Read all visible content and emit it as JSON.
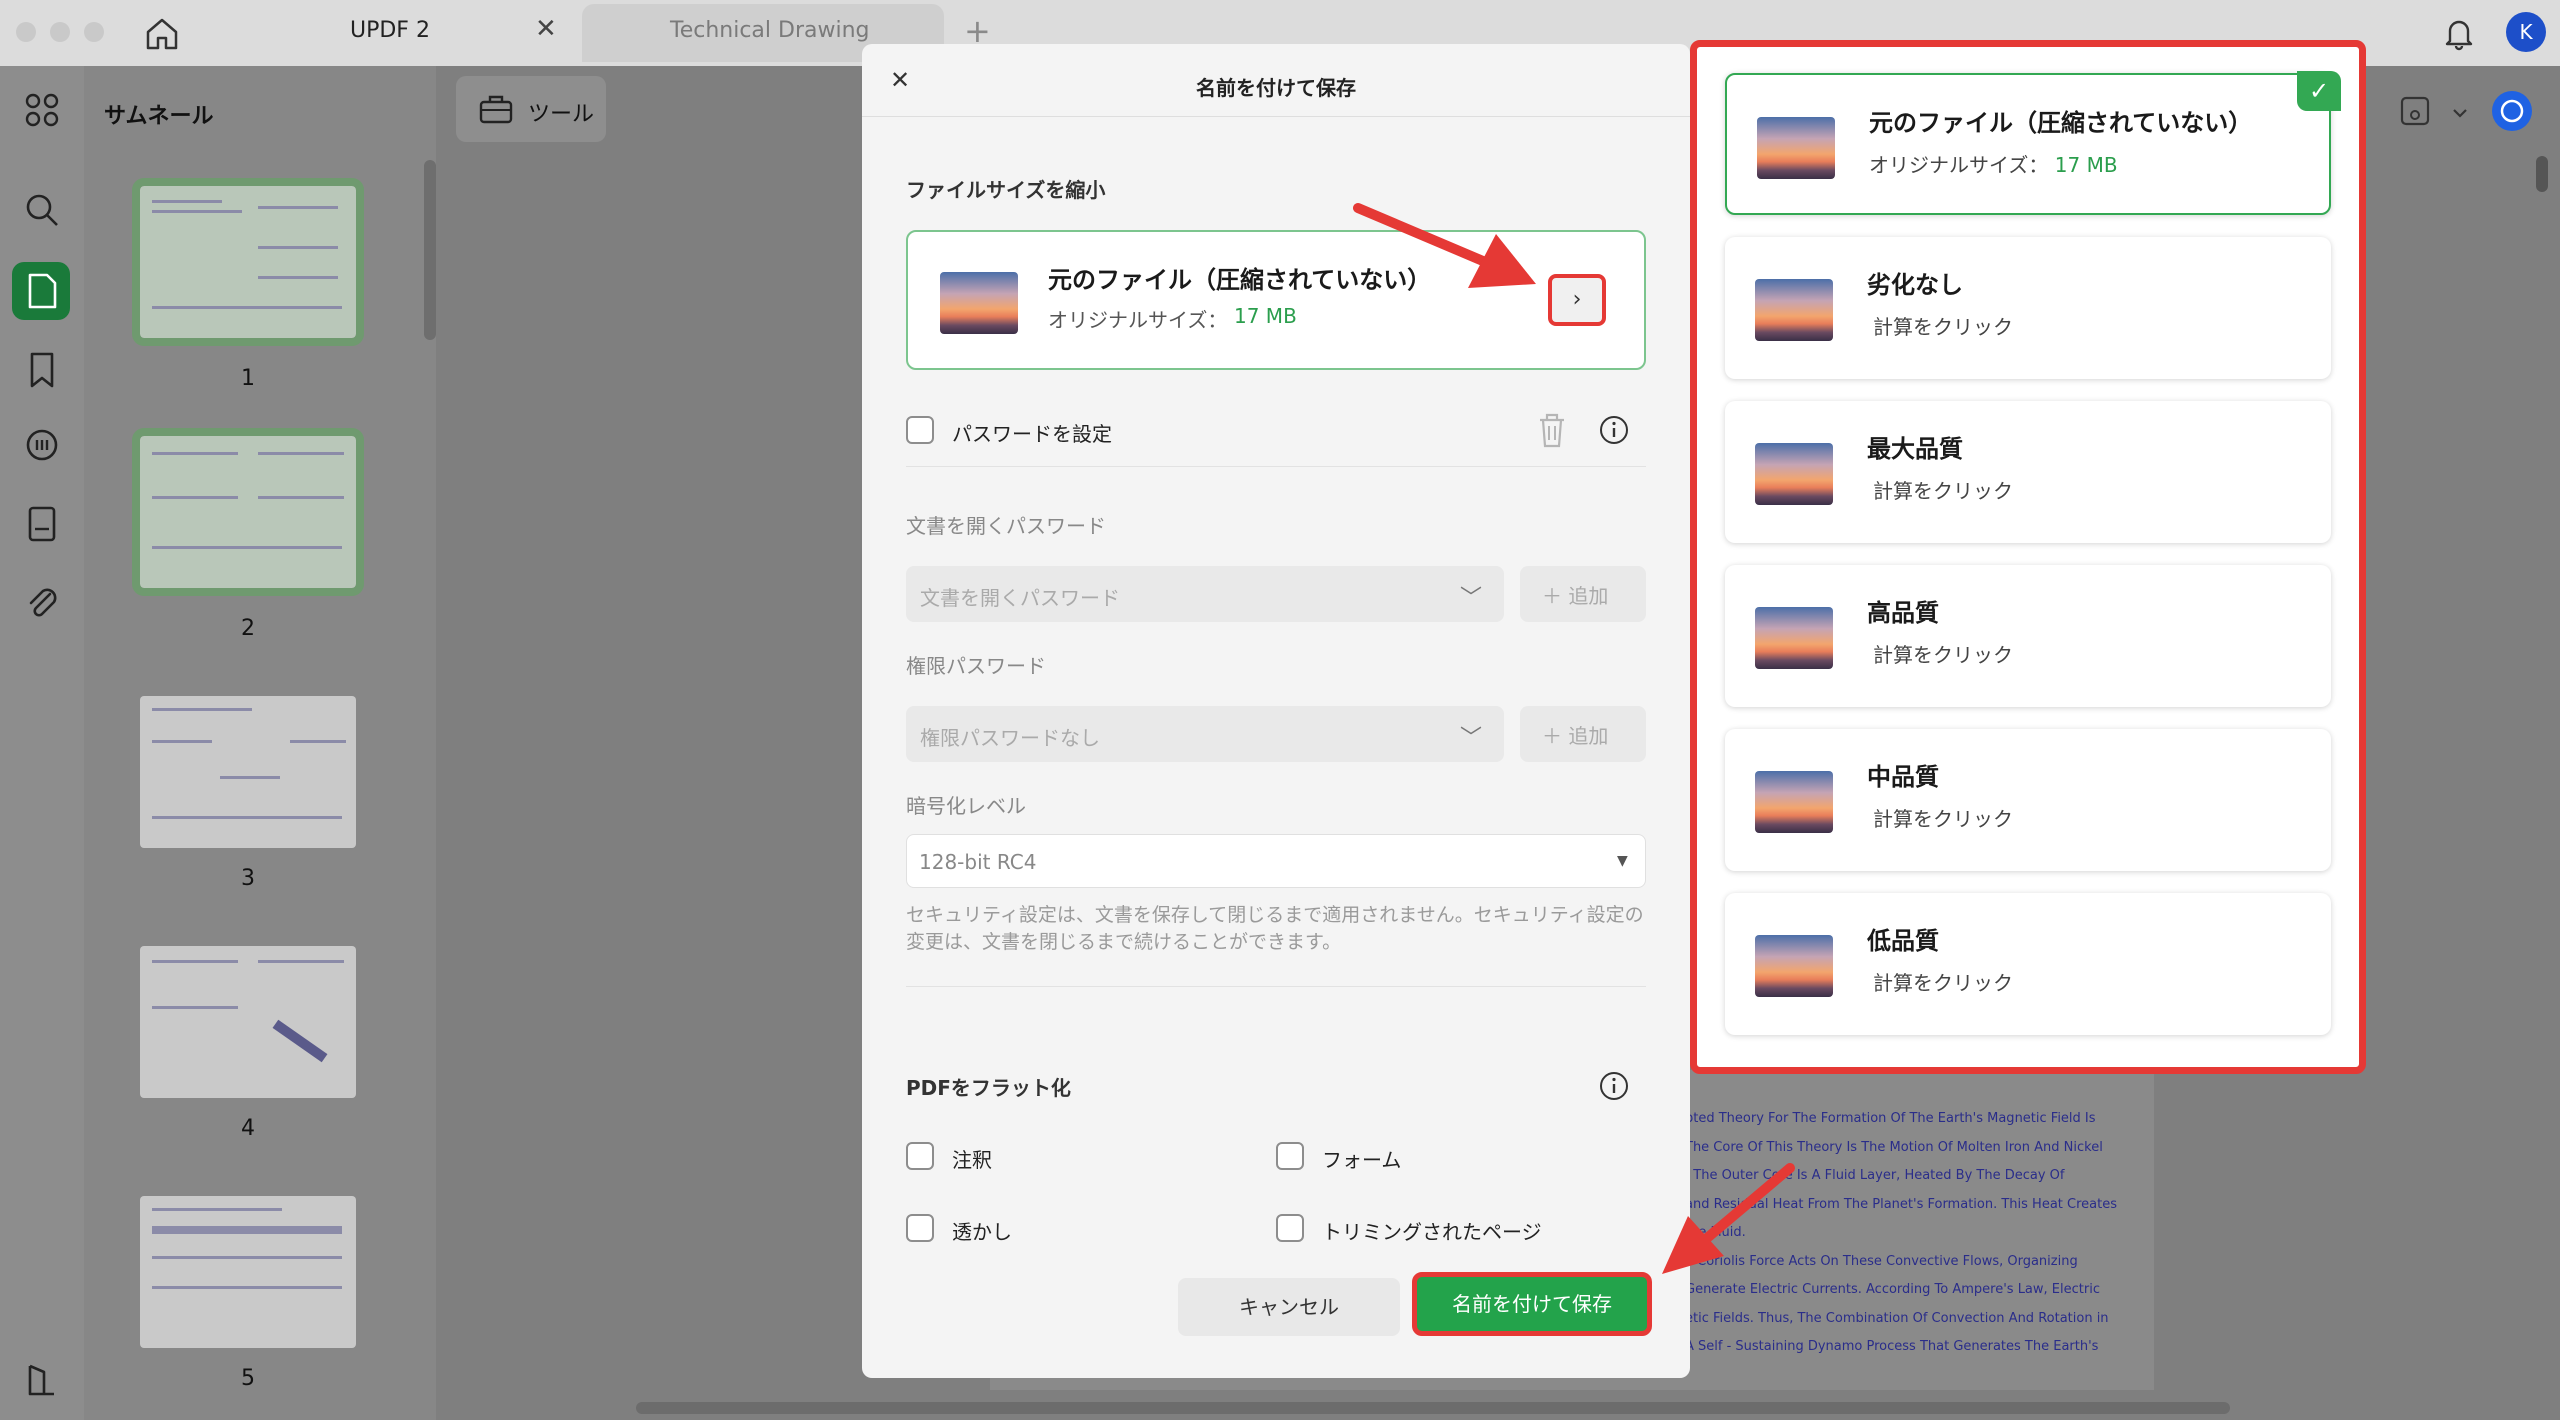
{
  "titlebar": {
    "tab_active": "UPDF 2",
    "tab_close": "✕",
    "tab_inactive": "Technical Drawing",
    "new_tab": "+",
    "avatar_initial": "K"
  },
  "thumbnails": {
    "title": "サムネール",
    "pages": [
      "1",
      "2",
      "3",
      "4",
      "5"
    ]
  },
  "toolbar": {
    "tools_label": "ツール"
  },
  "dialog": {
    "title": "名前を付けて保存",
    "close": "✕",
    "reduce_size_label": "ファイルサイズを縮小",
    "file_card": {
      "title": "元のファイル（圧縮されていない）",
      "size_label": "オリジナルサイズ：",
      "size_value": "17 MB",
      "expand": "›"
    },
    "password": {
      "set_label": "パスワードを設定",
      "open_label": "文書を開くパスワード",
      "open_placeholder": "文書を開くパスワード",
      "perm_label": "権限パスワード",
      "perm_placeholder": "権限パスワードなし",
      "add_label": "追加",
      "encryption_label": "暗号化レベル",
      "encryption_value": "128-bit RC4",
      "note": "セキュリティ設定は、文書を保存して閉じるまで適用されません。セキュリティ設定の変更は、文書を閉じるまで続けることができます。"
    },
    "flatten": {
      "label": "PDFをフラット化",
      "annotations": "注釈",
      "forms": "フォーム",
      "watermark": "透かし",
      "cropped": "トリミングされたページ"
    },
    "cancel": "キャンセル",
    "save": "名前を付けて保存"
  },
  "compression": {
    "options": [
      {
        "title": "元のファイル（圧縮されていない）",
        "sub": "オリジナルサイズ：",
        "size": "17 MB",
        "selected": true
      },
      {
        "title": "劣化なし",
        "sub": "計算をクリック"
      },
      {
        "title": "最大品質",
        "sub": "計算をクリック"
      },
      {
        "title": "高品質",
        "sub": "計算をクリック"
      },
      {
        "title": "中品質",
        "sub": "計算をクリック"
      },
      {
        "title": "低品質",
        "sub": "計算をクリック"
      }
    ]
  },
  "document": {
    "lines": [
      "pted Theory For The Formation Of The Earth's Magnetic Field Is",
      "The Core Of This Theory Is The Motion Of Molten Iron And Nickel",
      ". The Outer Core Is A Fluid Layer, Heated By The Decay Of",
      "and Residual Heat From The Planet's Formation. This Heat Creates",
      "the Fluid.",
      "e Coriolis Force Acts On These Convective Flows, Organizing",
      "Generate Electric Currents. According To Ampere's Law, Electric",
      "etic Fields. Thus, The Combination Of Convection And Rotation in",
      "A Self - Sustaining Dynamo Process That Generates The Earth's"
    ]
  },
  "colors": {
    "accent_green": "#23a34b",
    "highlight_red": "#e53935",
    "size_green": "#2b9e4d"
  }
}
